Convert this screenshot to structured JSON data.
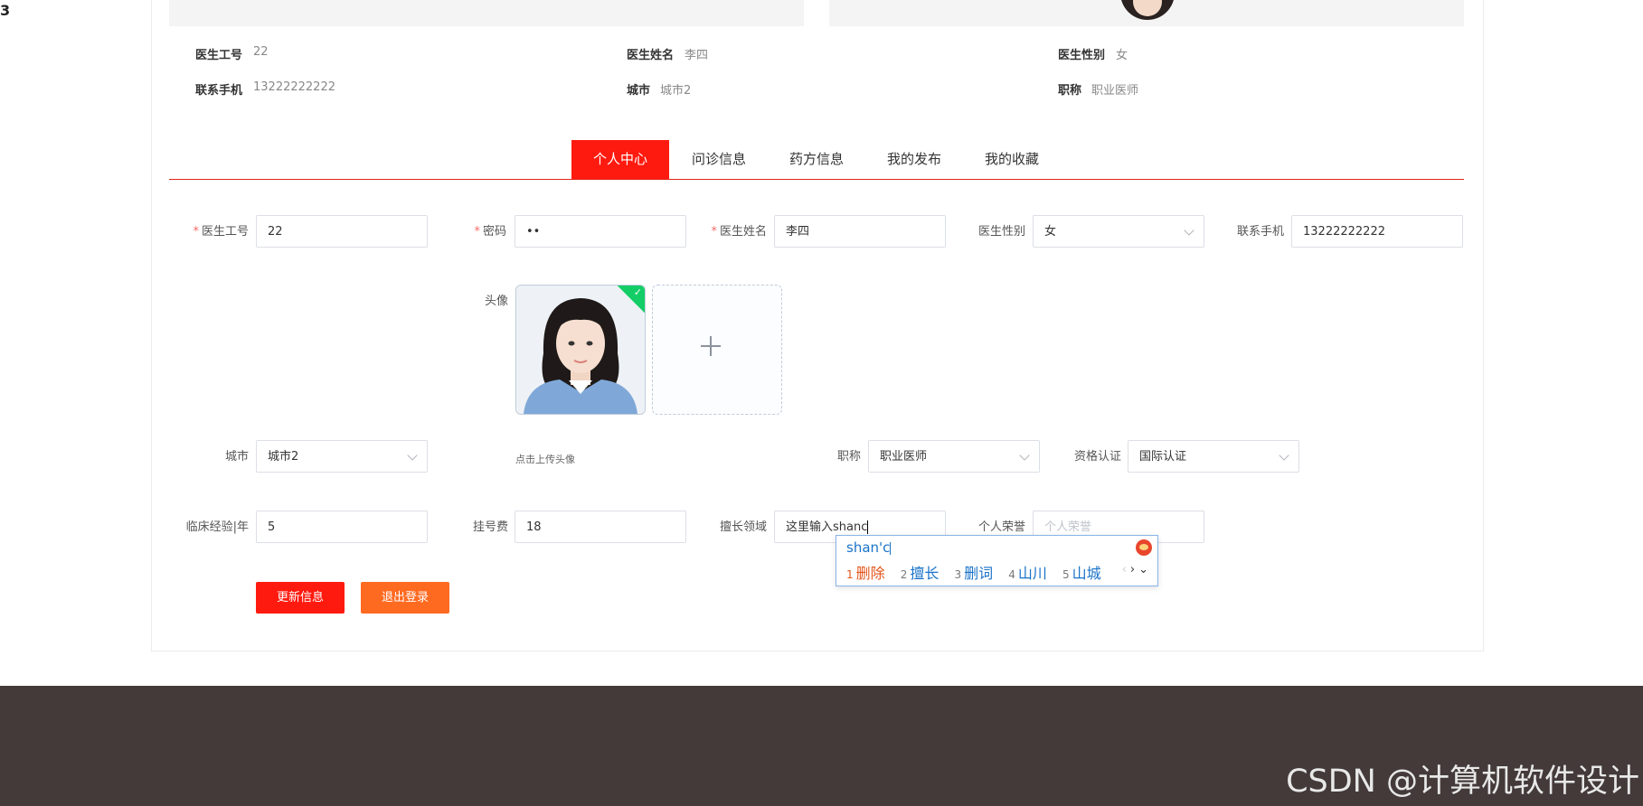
{
  "stray_char": "3",
  "profile_info": [
    {
      "label": "医生工号",
      "value": "22"
    },
    {
      "label": "医生姓名",
      "value": "李四"
    },
    {
      "label": "医生性别",
      "value": "女"
    },
    {
      "label": "联系手机",
      "value": "13222222222"
    },
    {
      "label": "城市",
      "value": "城市2"
    },
    {
      "label": "职称",
      "value": "职业医师"
    }
  ],
  "tabs": [
    {
      "label": "个人中心",
      "active": true
    },
    {
      "label": "问诊信息",
      "active": false
    },
    {
      "label": "药方信息",
      "active": false
    },
    {
      "label": "我的发布",
      "active": false
    },
    {
      "label": "我的收藏",
      "active": false
    }
  ],
  "form": {
    "doctor_id": {
      "label": "医生工号",
      "value": "22",
      "required": true
    },
    "password": {
      "label": "密码",
      "value": "••",
      "required": true
    },
    "name": {
      "label": "医生姓名",
      "value": "李四",
      "required": true
    },
    "gender": {
      "label": "医生性别",
      "value": "女"
    },
    "phone": {
      "label": "联系手机",
      "value": "13222222222"
    },
    "avatar": {
      "label": "头像",
      "hint": "点击上传头像"
    },
    "city": {
      "label": "城市",
      "value": "城市2"
    },
    "title": {
      "label": "职称",
      "value": "职业医师"
    },
    "qualification": {
      "label": "资格认证",
      "value": "国际认证"
    },
    "experience": {
      "label": "临床经验|年",
      "value": "5"
    },
    "fee": {
      "label": "挂号费",
      "value": "18"
    },
    "specialty": {
      "label": "擅长领域",
      "value": "这里输入shanc"
    },
    "honors": {
      "label": "个人荣誉",
      "placeholder": "个人荣誉"
    }
  },
  "buttons": {
    "update": "更新信息",
    "logout": "退出登录"
  },
  "ime": {
    "composition": "shan'c",
    "candidates": [
      {
        "num": "1",
        "text": "删除"
      },
      {
        "num": "2",
        "text": "擅长"
      },
      {
        "num": "3",
        "text": "删词"
      },
      {
        "num": "4",
        "text": "山川"
      },
      {
        "num": "5",
        "text": "山城"
      }
    ],
    "nav": {
      "prev": "‹",
      "next": "›",
      "expand": "⌄"
    }
  },
  "watermark": "CSDN @计算机软件设计",
  "colors": {
    "accent": "#ff1a0f",
    "logout": "#ff6a21",
    "footer": "#433a39"
  }
}
